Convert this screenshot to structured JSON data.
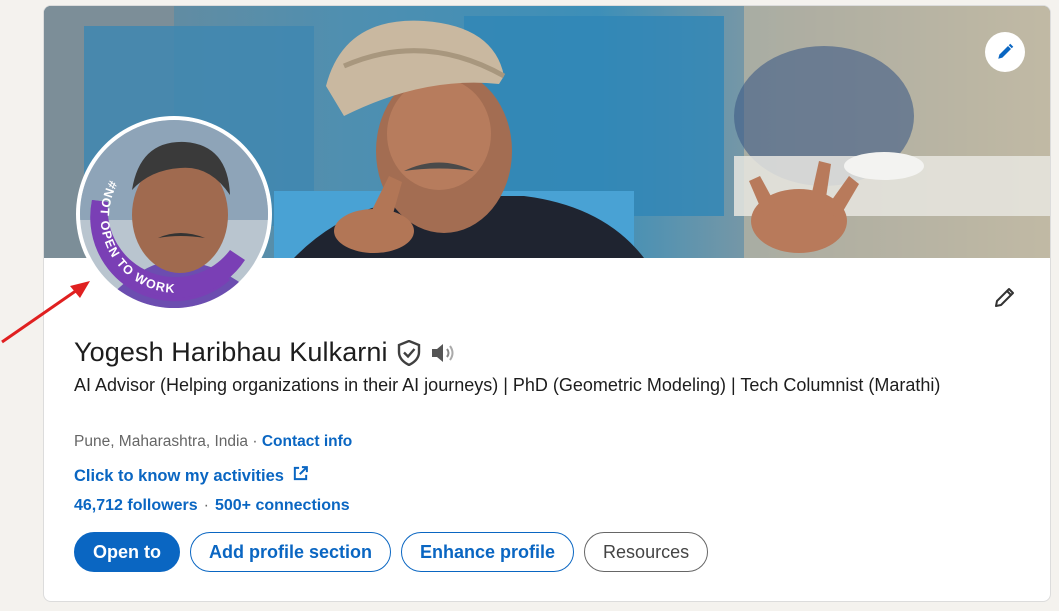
{
  "profile": {
    "name": "Yogesh Haribhau Kulkarni",
    "headline": "AI Advisor (Helping organizations in their AI journeys) | PhD (Geometric Modeling) | Tech Columnist (Marathi)",
    "location": "Pune, Maharashtra, India",
    "location_separator": " · ",
    "contact_info_label": "Contact info",
    "activities_link_label": "Click to know my activities",
    "followers_label": "46,712 followers",
    "stats_separator": "·",
    "connections_label": "500+ connections",
    "avatar_frame_text": "#NOT OPEN TO WORK"
  },
  "actions": {
    "open_to_label": "Open to",
    "add_section_label": "Add profile section",
    "enhance_label": "Enhance profile",
    "resources_label": "Resources"
  },
  "icons": {
    "banner_edit": "pencil-icon",
    "profile_edit": "pencil-icon",
    "verified": "shield-check-icon",
    "name_pronunciation": "speaker-icon",
    "external_link": "external-link-icon",
    "annotation": "red-arrow-icon"
  },
  "colors": {
    "brand_blue": "#0a66c2",
    "frame_purple": "#7a3fb5",
    "annotation_red": "#e02020",
    "text_primary": "#1d1d1d",
    "text_secondary": "#666666"
  }
}
